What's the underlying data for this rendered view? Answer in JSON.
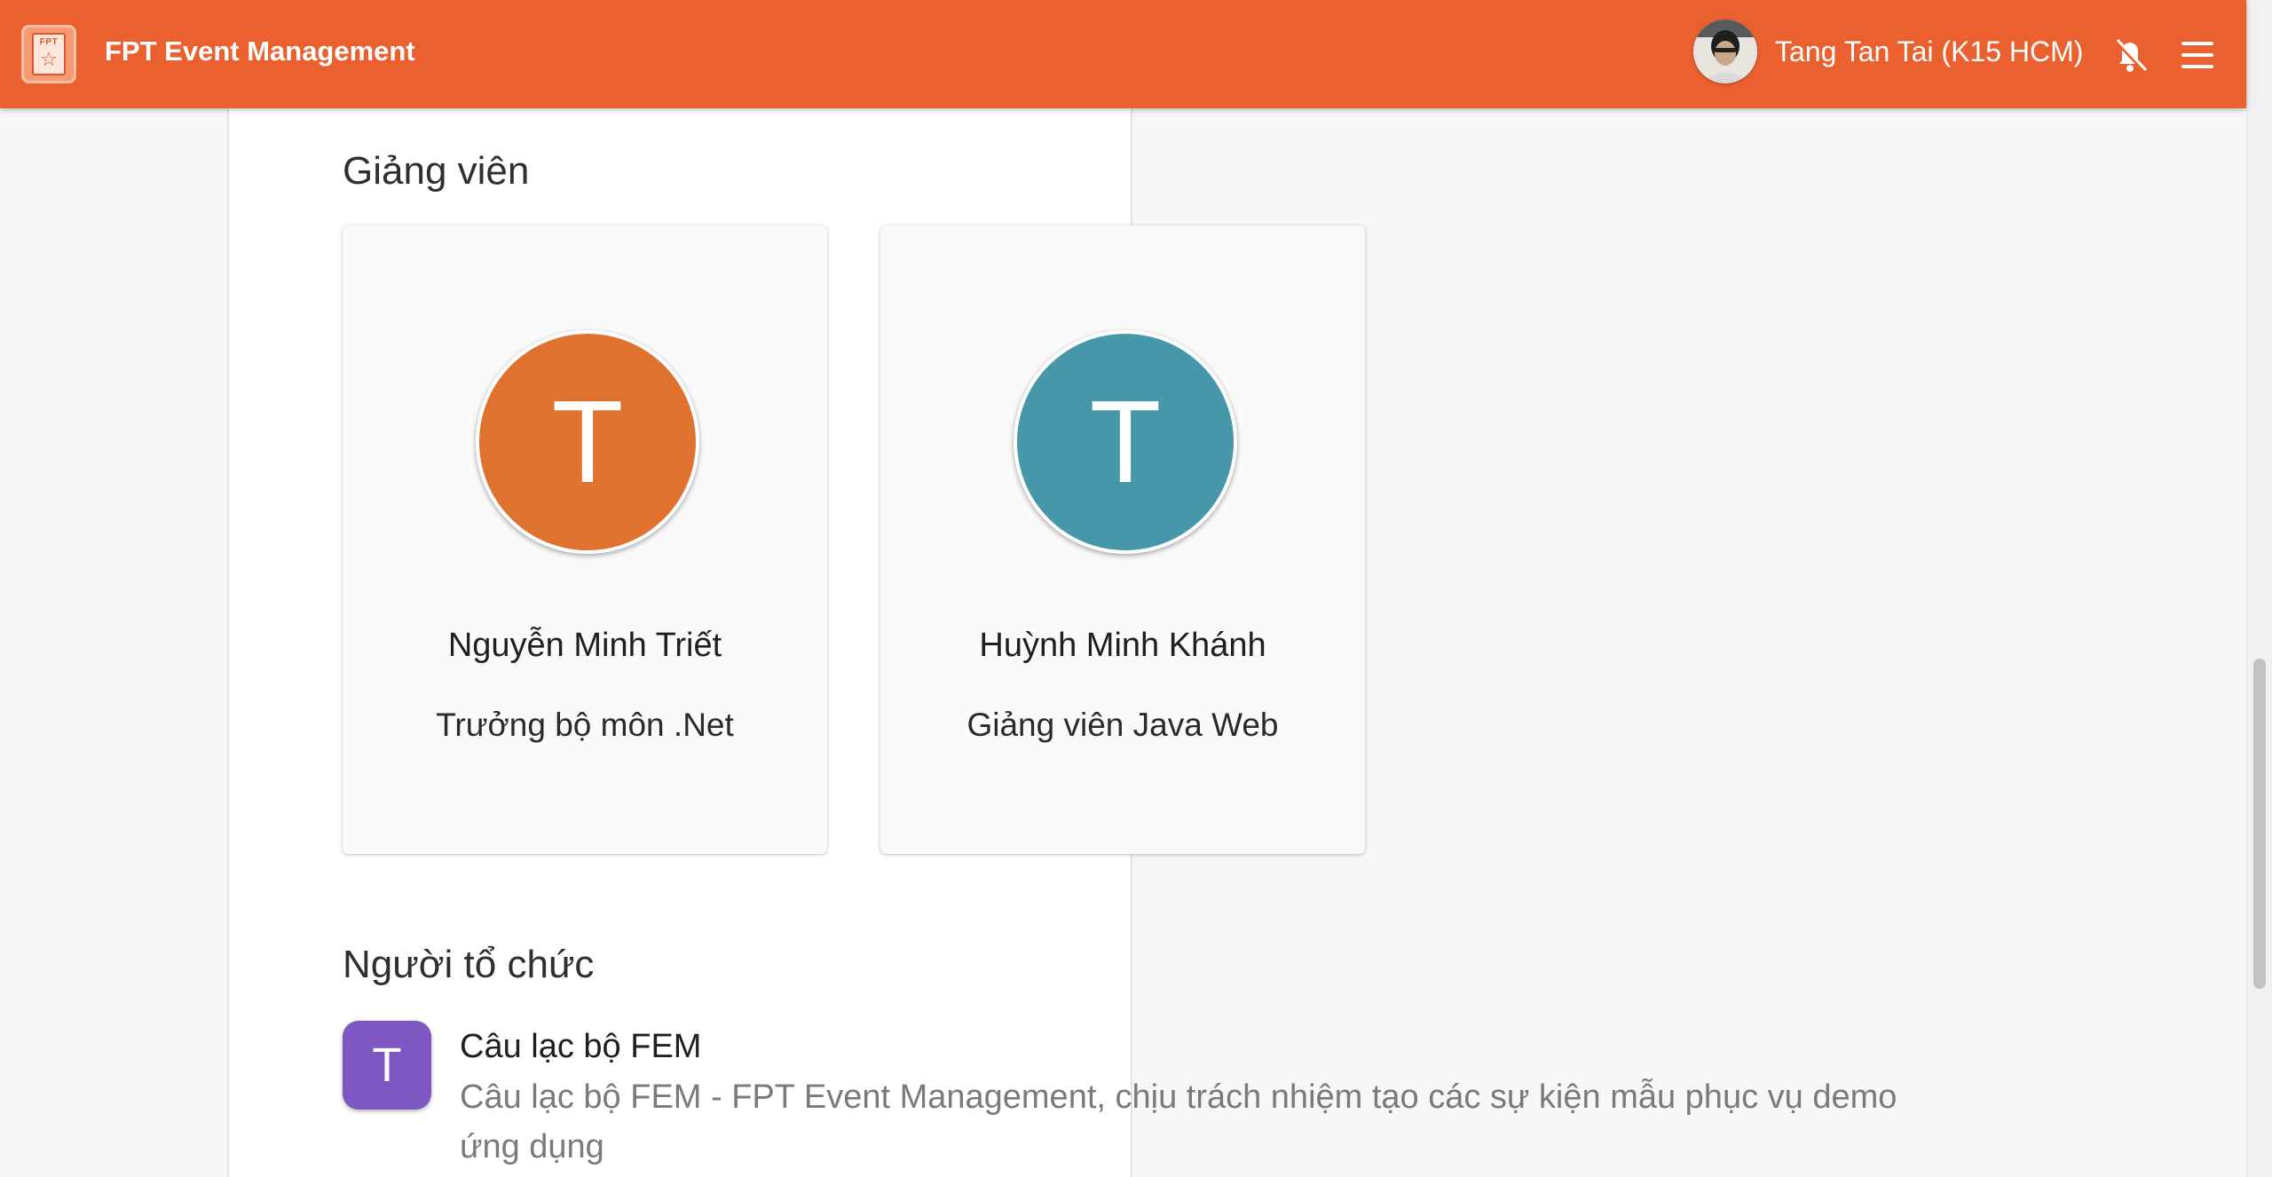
{
  "app": {
    "title": "FPT Event Management",
    "logo_text": "FPT",
    "user_name": "Tang Tan Tai (K15 HCM)",
    "accent_color": "#ea602f"
  },
  "lecturers": {
    "heading": "Giảng viên",
    "items": [
      {
        "initial": "T",
        "name": "Nguyễn Minh Triết",
        "role": "Trưởng bộ môn .Net",
        "color": "#e07230"
      },
      {
        "initial": "T",
        "name": "Huỳnh Minh Khánh",
        "role": "Giảng viên Java Web",
        "color": "#4597a9"
      }
    ]
  },
  "organizer": {
    "heading": "Người tổ chức",
    "initial": "T",
    "name": "Câu lạc bộ FEM",
    "description": "Câu lạc bộ FEM - FPT Event Management, chịu trách nhiệm tạo các sự kiện mẫu phục vụ demo ứng dụng",
    "color": "#7e57c2"
  },
  "icons": [
    "fpt-logo-icon",
    "user-avatar",
    "bell-icon",
    "menu-icon"
  ]
}
